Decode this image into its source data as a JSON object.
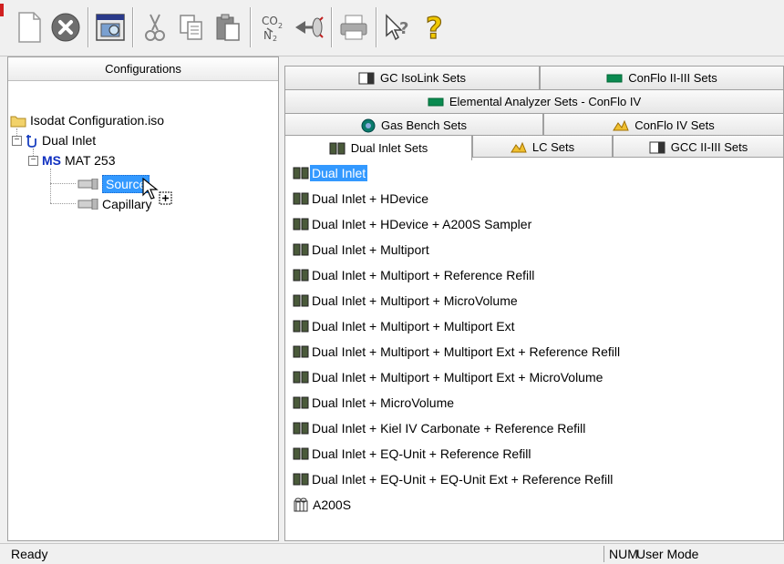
{
  "toolbar": {
    "buttons": [
      {
        "icon": "new-document-icon"
      },
      {
        "icon": "close-circle-icon"
      },
      {
        "icon": "window-config-icon"
      },
      {
        "icon": "cut-icon"
      },
      {
        "icon": "copy-icon"
      },
      {
        "icon": "paste-icon"
      },
      {
        "icon": "co2-gas-icon"
      },
      {
        "icon": "valve-arrow-icon"
      },
      {
        "icon": "print-icon"
      },
      {
        "icon": "context-help-icon"
      },
      {
        "icon": "help-icon"
      }
    ]
  },
  "left_pane": {
    "header": "Configurations",
    "tree": {
      "root": "Isodat Configuration.iso",
      "dual_inlet": "Dual Inlet",
      "ms_prefix": "MS",
      "ms_label": "MAT 253",
      "source": "Source",
      "capillary": "Capillary"
    }
  },
  "tabs": {
    "row1": [
      "GC IsoLink Sets",
      "ConFlo II-III Sets"
    ],
    "row2": [
      "Elemental Analyzer Sets - ConFlo IV"
    ],
    "row3": [
      "Gas Bench Sets",
      "ConFlo IV Sets"
    ],
    "row4": [
      "Dual Inlet Sets",
      "LC Sets",
      "GCC II-III Sets"
    ]
  },
  "list": [
    "Dual Inlet",
    "Dual Inlet + HDevice",
    "Dual Inlet + HDevice + A200S Sampler",
    "Dual Inlet + Multiport",
    "Dual Inlet + Multiport + Reference Refill",
    "Dual Inlet + Multiport + MicroVolume",
    "Dual Inlet + Multiport + Multiport Ext",
    "Dual Inlet + Multiport + Multiport Ext + Reference Refill",
    "Dual Inlet + Multiport + Multiport Ext + MicroVolume",
    "Dual Inlet + MicroVolume",
    "Dual Inlet + Kiel IV Carbonate + Reference Refill",
    "Dual Inlet + EQ-Unit + Reference Refill",
    "Dual Inlet + EQ-Unit + EQ-Unit Ext + Reference Refill",
    "A200S"
  ],
  "status": {
    "left": "Ready",
    "num": "NUM",
    "mode": "User Mode"
  },
  "colors": {
    "selection": "#3399ff",
    "ms_blue": "#1030c0"
  }
}
